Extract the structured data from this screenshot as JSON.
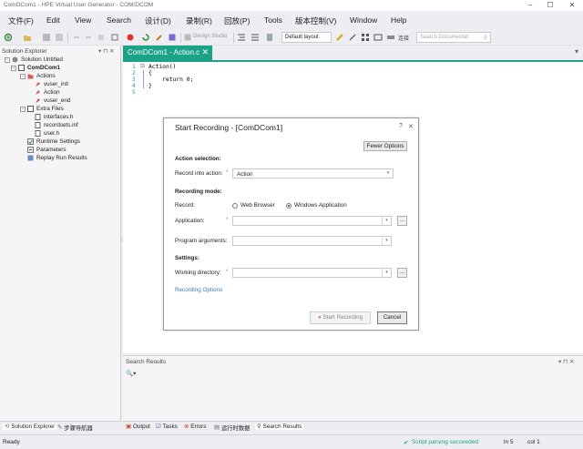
{
  "window": {
    "title": "ComDCom1 - HPE Virtual User Generator - COM/DCOM",
    "controls": [
      "–",
      "☐",
      "✕"
    ]
  },
  "menu": [
    "文件(F)",
    "Edit",
    "View",
    "Search",
    "设计(D)",
    "录制(R)",
    "回放(P)",
    "Tools",
    "版本控制(V)",
    "Window",
    "Help"
  ],
  "toolbar": {
    "design_studio": "Design Studio",
    "layout": "Default layout",
    "search_placeholder": "Search Documentat"
  },
  "solution_explorer": {
    "title": "Solution Explorer",
    "pin": "▾ ⊓ ✕",
    "items": [
      {
        "label": "Solution Untitled",
        "exp": "−"
      },
      {
        "label": "ComDCom1",
        "exp": "−"
      },
      {
        "label": "Actions",
        "exp": "−"
      },
      {
        "label": "vuser_init",
        "exp": ""
      },
      {
        "label": "Action",
        "exp": ""
      },
      {
        "label": "vuser_end",
        "exp": ""
      },
      {
        "label": "Extra Files",
        "exp": "−"
      },
      {
        "label": "interfaces.h",
        "exp": ""
      },
      {
        "label": "recordsets.inf",
        "exp": ""
      },
      {
        "label": "user.h",
        "exp": ""
      },
      {
        "label": "Runtime Settings",
        "exp": ""
      },
      {
        "label": "Parameters",
        "exp": ""
      },
      {
        "label": "Replay Run Results",
        "exp": ""
      }
    ],
    "tabs": [
      "Solution Explorer",
      "步骤导航器"
    ]
  },
  "editor": {
    "tab_label": "ComDCom1 - Action.c",
    "tab_close": "✕",
    "line_numbers": [
      "1",
      "2",
      "3",
      "4",
      "5"
    ],
    "lines": [
      "Action()",
      "{",
      "    return 0;",
      "}",
      ""
    ]
  },
  "dialog": {
    "title": "Start Recording - [ComDCom1]",
    "help": "?",
    "close": "✕",
    "fewer_options": "Fewer Options",
    "section_action": "Action selection:",
    "record_into_label": "Record into action:",
    "required_mark": "*",
    "record_into_value": "Action",
    "section_mode": "Recording mode:",
    "record_label": "Record:",
    "radio_web": "Web Browser",
    "radio_windows": "Windows Application",
    "application_label": "Application:",
    "application_value": "",
    "args_label": "Program arguments:",
    "args_value": "",
    "section_settings": "Settings:",
    "workdir_label": "Working directory:",
    "workdir_value": "",
    "browse": "...",
    "recording_options": "Recording Options",
    "start_recording": "Start Recording",
    "cancel": "Cancel"
  },
  "search_results": {
    "title": "Search Results",
    "pin": "▾ ⊓ ✕",
    "filter": "🔍▾",
    "tabs": [
      "Output",
      "Tasks",
      "Errors",
      "运行时数据",
      "Search Results"
    ]
  },
  "status": {
    "ready": "Ready",
    "parsing": "Script parsing succeeded",
    "ln": "ln 5",
    "col": "col 1"
  },
  "colors": {
    "accent": "#1ca387",
    "link": "#3d7bbf",
    "success": "#1ca387"
  }
}
